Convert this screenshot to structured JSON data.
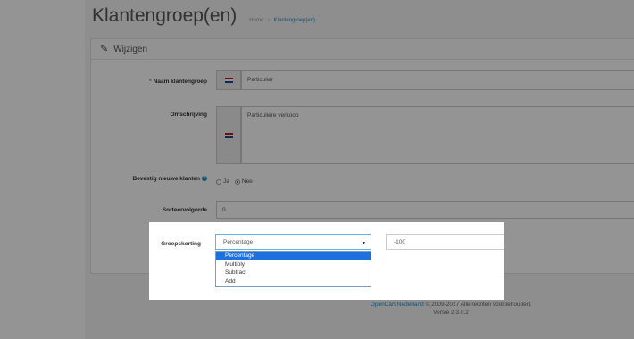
{
  "page": {
    "title": "Klantengroep(en)",
    "breadcrumb": [
      "Home",
      "Klantengroep(en)"
    ],
    "separator": "›"
  },
  "panel": {
    "title": "Wijzigen",
    "icon": "pencil-icon"
  },
  "form": {
    "name": {
      "label": "Naam klantengroep",
      "required": "*",
      "value": "Particulier"
    },
    "description": {
      "label": "Omschrijving",
      "value": "Particuliere verkoop"
    },
    "approve": {
      "label": "Bevestig nieuwe klanten",
      "help": "?",
      "options": [
        "Ja",
        "Nee"
      ],
      "selected": "Nee"
    },
    "sort_order": {
      "label": "Sorteervolgorde",
      "value": "0"
    },
    "discount": {
      "label": "Groepskorting",
      "type_value": "Percentage",
      "caret": "▾",
      "options": [
        "Percentage",
        "Multiply",
        "Subtract",
        "Add"
      ],
      "highlighted": "Percentage",
      "amount": "-100"
    }
  },
  "footer": {
    "link": "OpenCart Nederland",
    "copyright": " © 2009-2017 Alle rechten voorbehouden.",
    "version": "Versie 2.3.0.2"
  },
  "colors": {
    "link": "#1e91cf",
    "selected_option": "#1e70e0",
    "flag": [
      "#ae1c28",
      "#ffffff",
      "#21468b"
    ]
  }
}
